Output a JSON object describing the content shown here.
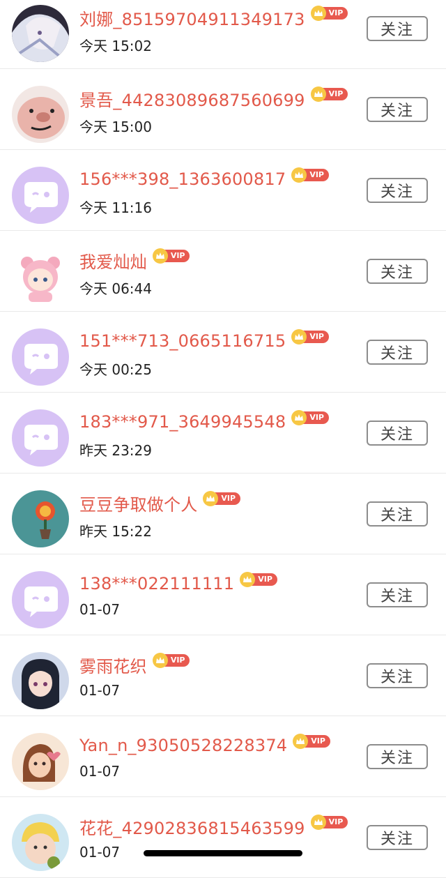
{
  "users": [
    {
      "name": "刘娜_85159704911349173",
      "time": "今天 15:02",
      "follow": "关注",
      "vip": "VIP",
      "avatar": "anime-portrait-avatar"
    },
    {
      "name": "景吾_44283089687560699",
      "time": "今天 15:00",
      "follow": "关注",
      "vip": "VIP",
      "avatar": "pig-toy-avatar"
    },
    {
      "name": "156***398_1363600817",
      "time": "今天 11:16",
      "follow": "关注",
      "vip": "VIP",
      "avatar": "default-chat-avatar"
    },
    {
      "name": "我爱灿灿",
      "time": "今天 06:44",
      "follow": "关注",
      "vip": "VIP",
      "avatar": "cartoon-bear-hood-avatar"
    },
    {
      "name": "151***713_0665116715",
      "time": "今天 00:25",
      "follow": "关注",
      "vip": "VIP",
      "avatar": "default-chat-avatar"
    },
    {
      "name": "183***971_3649945548",
      "time": "昨天 23:29",
      "follow": "关注",
      "vip": "VIP",
      "avatar": "default-chat-avatar"
    },
    {
      "name": "豆豆争取做个人",
      "time": "昨天 15:22",
      "follow": "关注",
      "vip": "VIP",
      "avatar": "flower-pot-avatar"
    },
    {
      "name": "138***022111111",
      "time": "01-07",
      "follow": "关注",
      "vip": "VIP",
      "avatar": "default-chat-avatar"
    },
    {
      "name": "雾雨花织",
      "time": "01-07",
      "follow": "关注",
      "vip": "VIP",
      "avatar": "anime-girl-avatar"
    },
    {
      "name": "Yan_n_93050528228374",
      "time": "01-07",
      "follow": "关注",
      "vip": "VIP",
      "avatar": "cartoon-girl-avatar"
    },
    {
      "name": "花花_42902836815463599",
      "time": "01-07",
      "follow": "关注",
      "vip": "VIP",
      "avatar": "baby-photo-avatar"
    }
  ],
  "colors": {
    "name": "#e2594a",
    "vip_tag": "#e8594f",
    "crown": "#f7c744",
    "default_avatar": "#d7c2f5"
  }
}
